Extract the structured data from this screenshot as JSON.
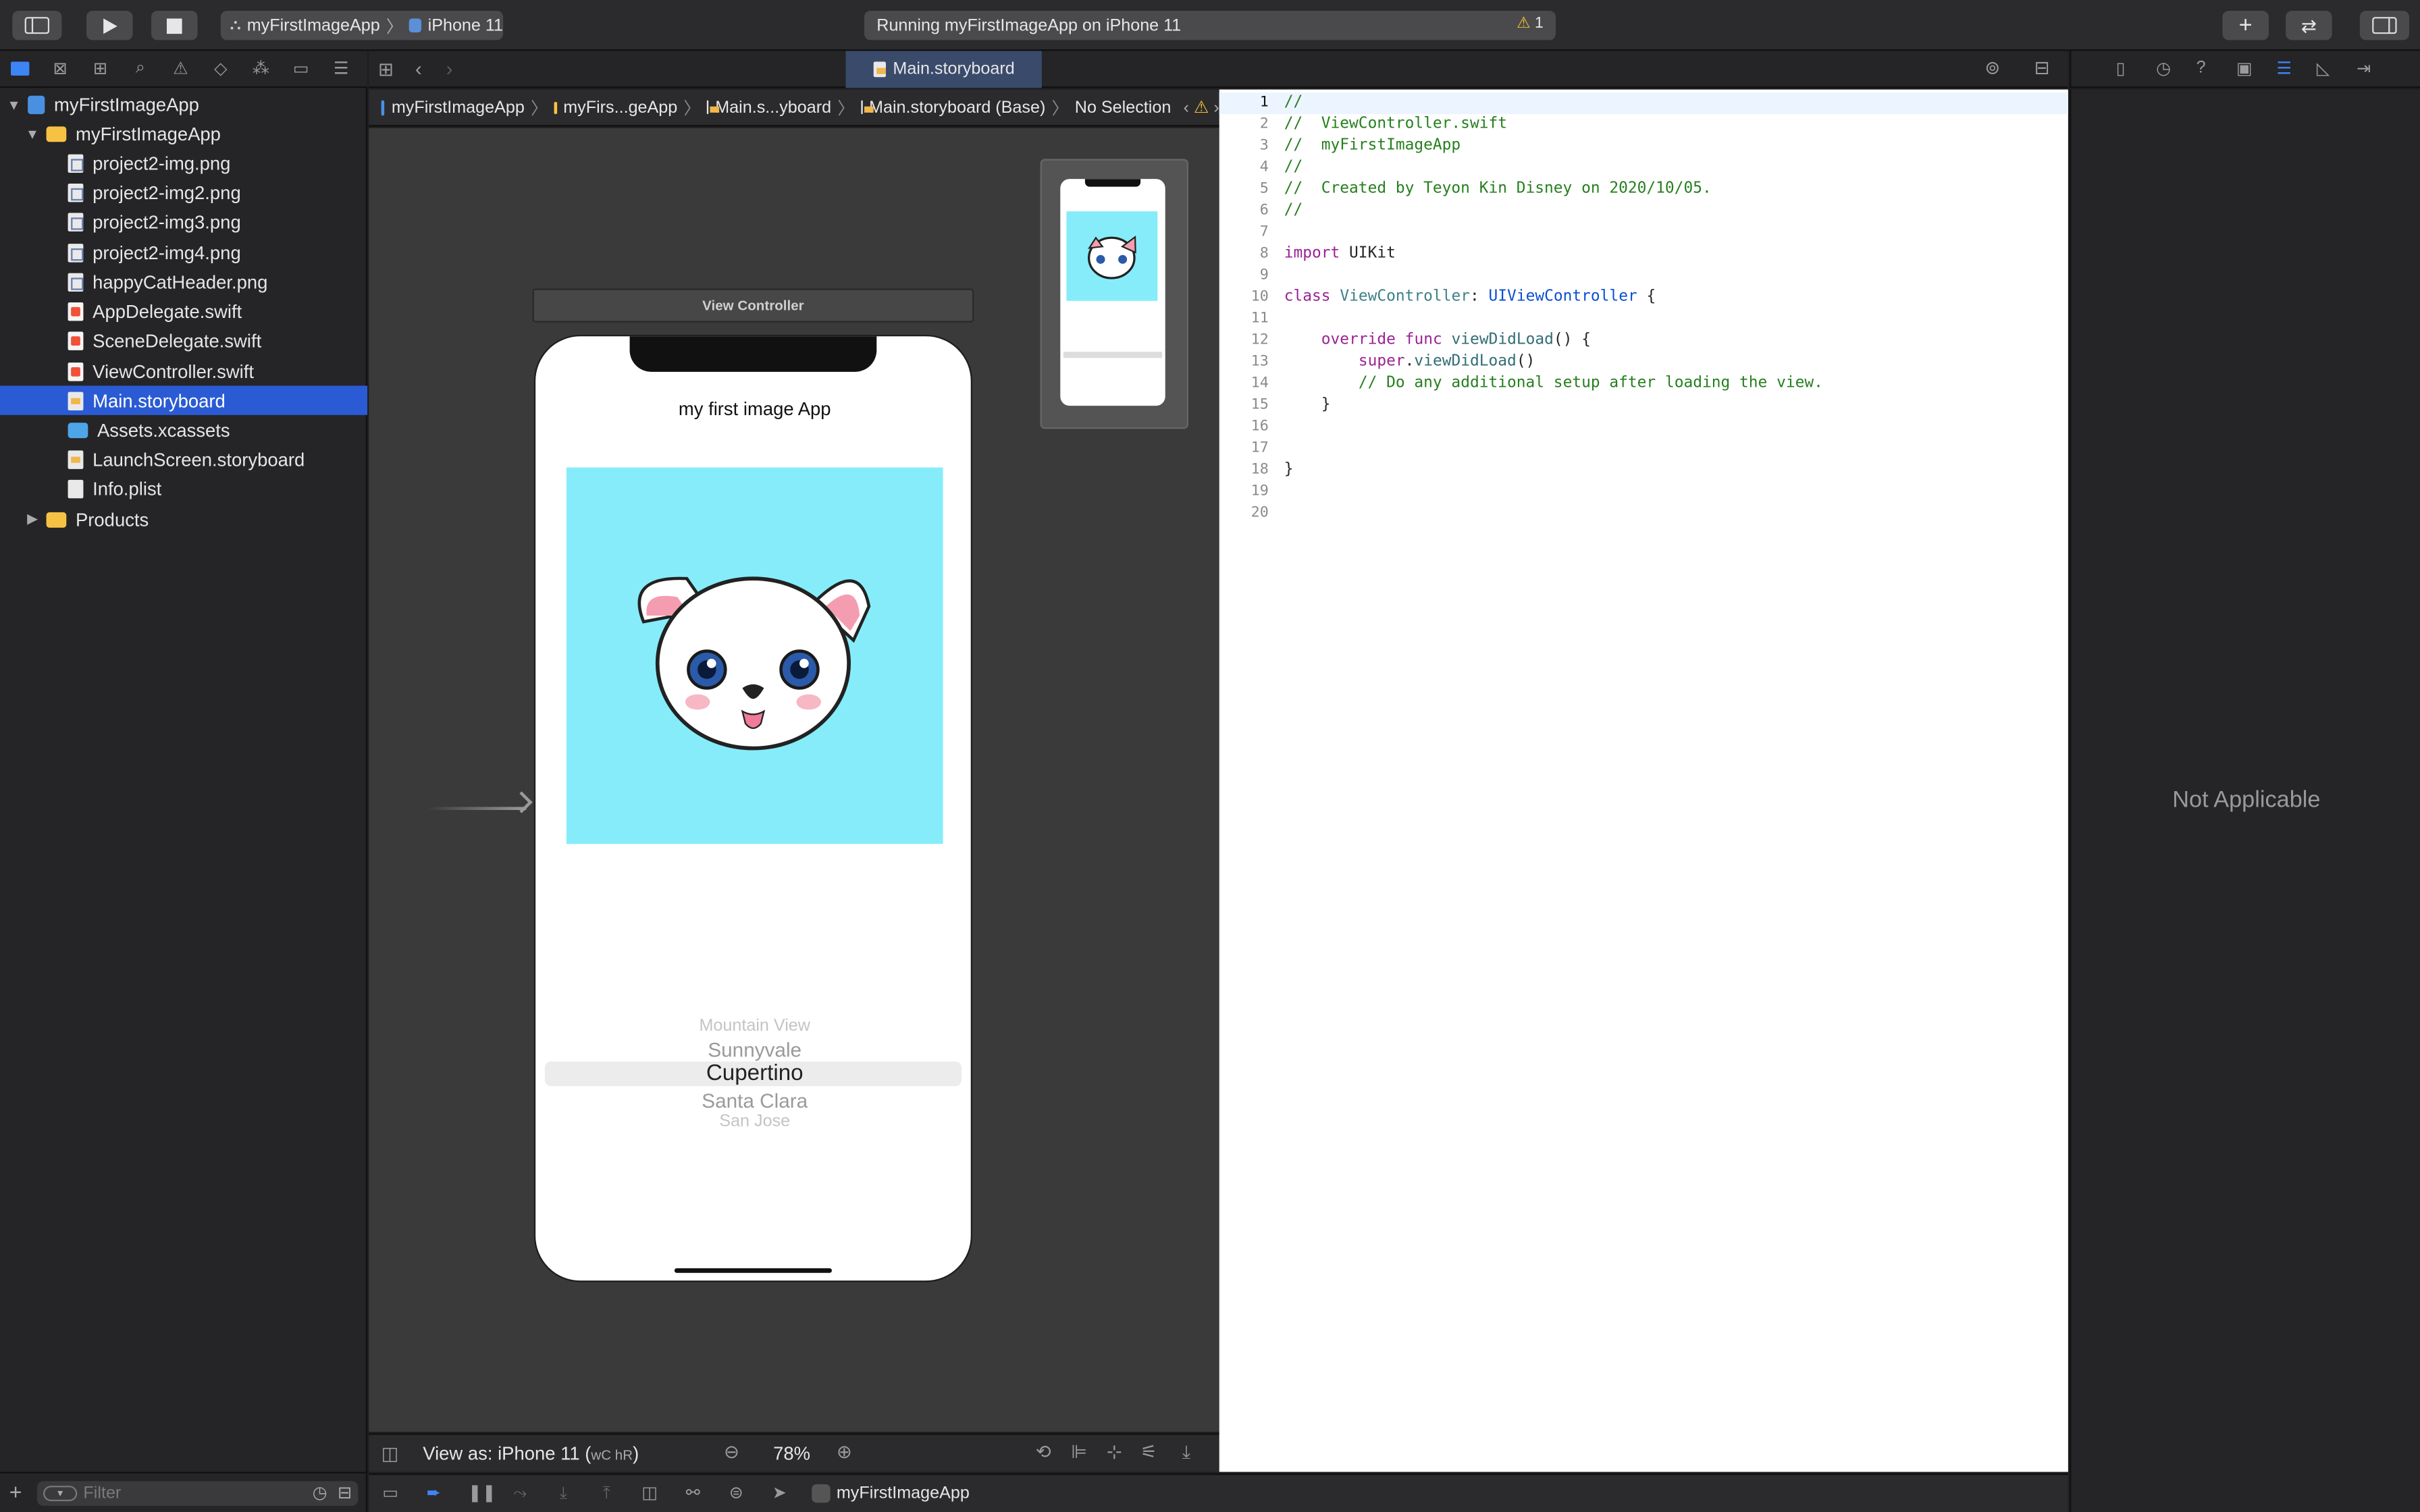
{
  "toolbar": {
    "scheme_target": "myFirstImageApp",
    "scheme_device": "iPhone 11",
    "activity_text": "Running myFirstImageApp on iPhone 11",
    "warning_count": "1"
  },
  "navigator": {
    "items": [
      {
        "label": "myFirstImageApp",
        "kind": "project"
      },
      {
        "label": "myFirstImageApp",
        "kind": "folder"
      },
      {
        "label": "project2-img.png",
        "kind": "image"
      },
      {
        "label": "project2-img2.png",
        "kind": "image"
      },
      {
        "label": "project2-img3.png",
        "kind": "image"
      },
      {
        "label": "project2-img4.png",
        "kind": "image"
      },
      {
        "label": "happyCatHeader.png",
        "kind": "image"
      },
      {
        "label": "AppDelegate.swift",
        "kind": "swift"
      },
      {
        "label": "SceneDelegate.swift",
        "kind": "swift"
      },
      {
        "label": "ViewController.swift",
        "kind": "swift"
      },
      {
        "label": "Main.storyboard",
        "kind": "storyboard",
        "selected": true
      },
      {
        "label": "Assets.xcassets",
        "kind": "assets"
      },
      {
        "label": "LaunchScreen.storyboard",
        "kind": "storyboard"
      },
      {
        "label": "Info.plist",
        "kind": "plist"
      },
      {
        "label": "Products",
        "kind": "folder"
      }
    ],
    "filter_placeholder": "Filter"
  },
  "tab": {
    "label": "Main.storyboard"
  },
  "jumpbar": {
    "crumbs": [
      "myFirstImageApp",
      "myFirs...geApp",
      "Main.s...yboard",
      "Main.storyboard (Base)",
      "No Selection"
    ]
  },
  "canvas": {
    "scene_title": "View Controller",
    "app_label": "my first image App",
    "picker_items": [
      "Mountain View",
      "Sunnyvale",
      "Cupertino",
      "Santa Clara",
      "San Jose"
    ],
    "picker_selected": "Cupertino",
    "view_as": "View as: iPhone 11 (",
    "size_class": "wC hR",
    "view_as_close": ")",
    "zoom": "78%"
  },
  "code": {
    "lines": [
      "//",
      "//  ViewController.swift",
      "//  myFirstImageApp",
      "//",
      "//  Created by Teyon Kin Disney on 2020/10/05.",
      "//",
      "",
      "import UIKit",
      "",
      "class ViewController: UIViewController {",
      "",
      "    override func viewDidLoad() {",
      "        super.viewDidLoad()",
      "        // Do any additional setup after loading the view.",
      "    }",
      "",
      "",
      "}",
      "",
      ""
    ]
  },
  "inspector": {
    "empty_text": "Not Applicable"
  },
  "debug": {
    "target_label": "myFirstImageApp"
  }
}
